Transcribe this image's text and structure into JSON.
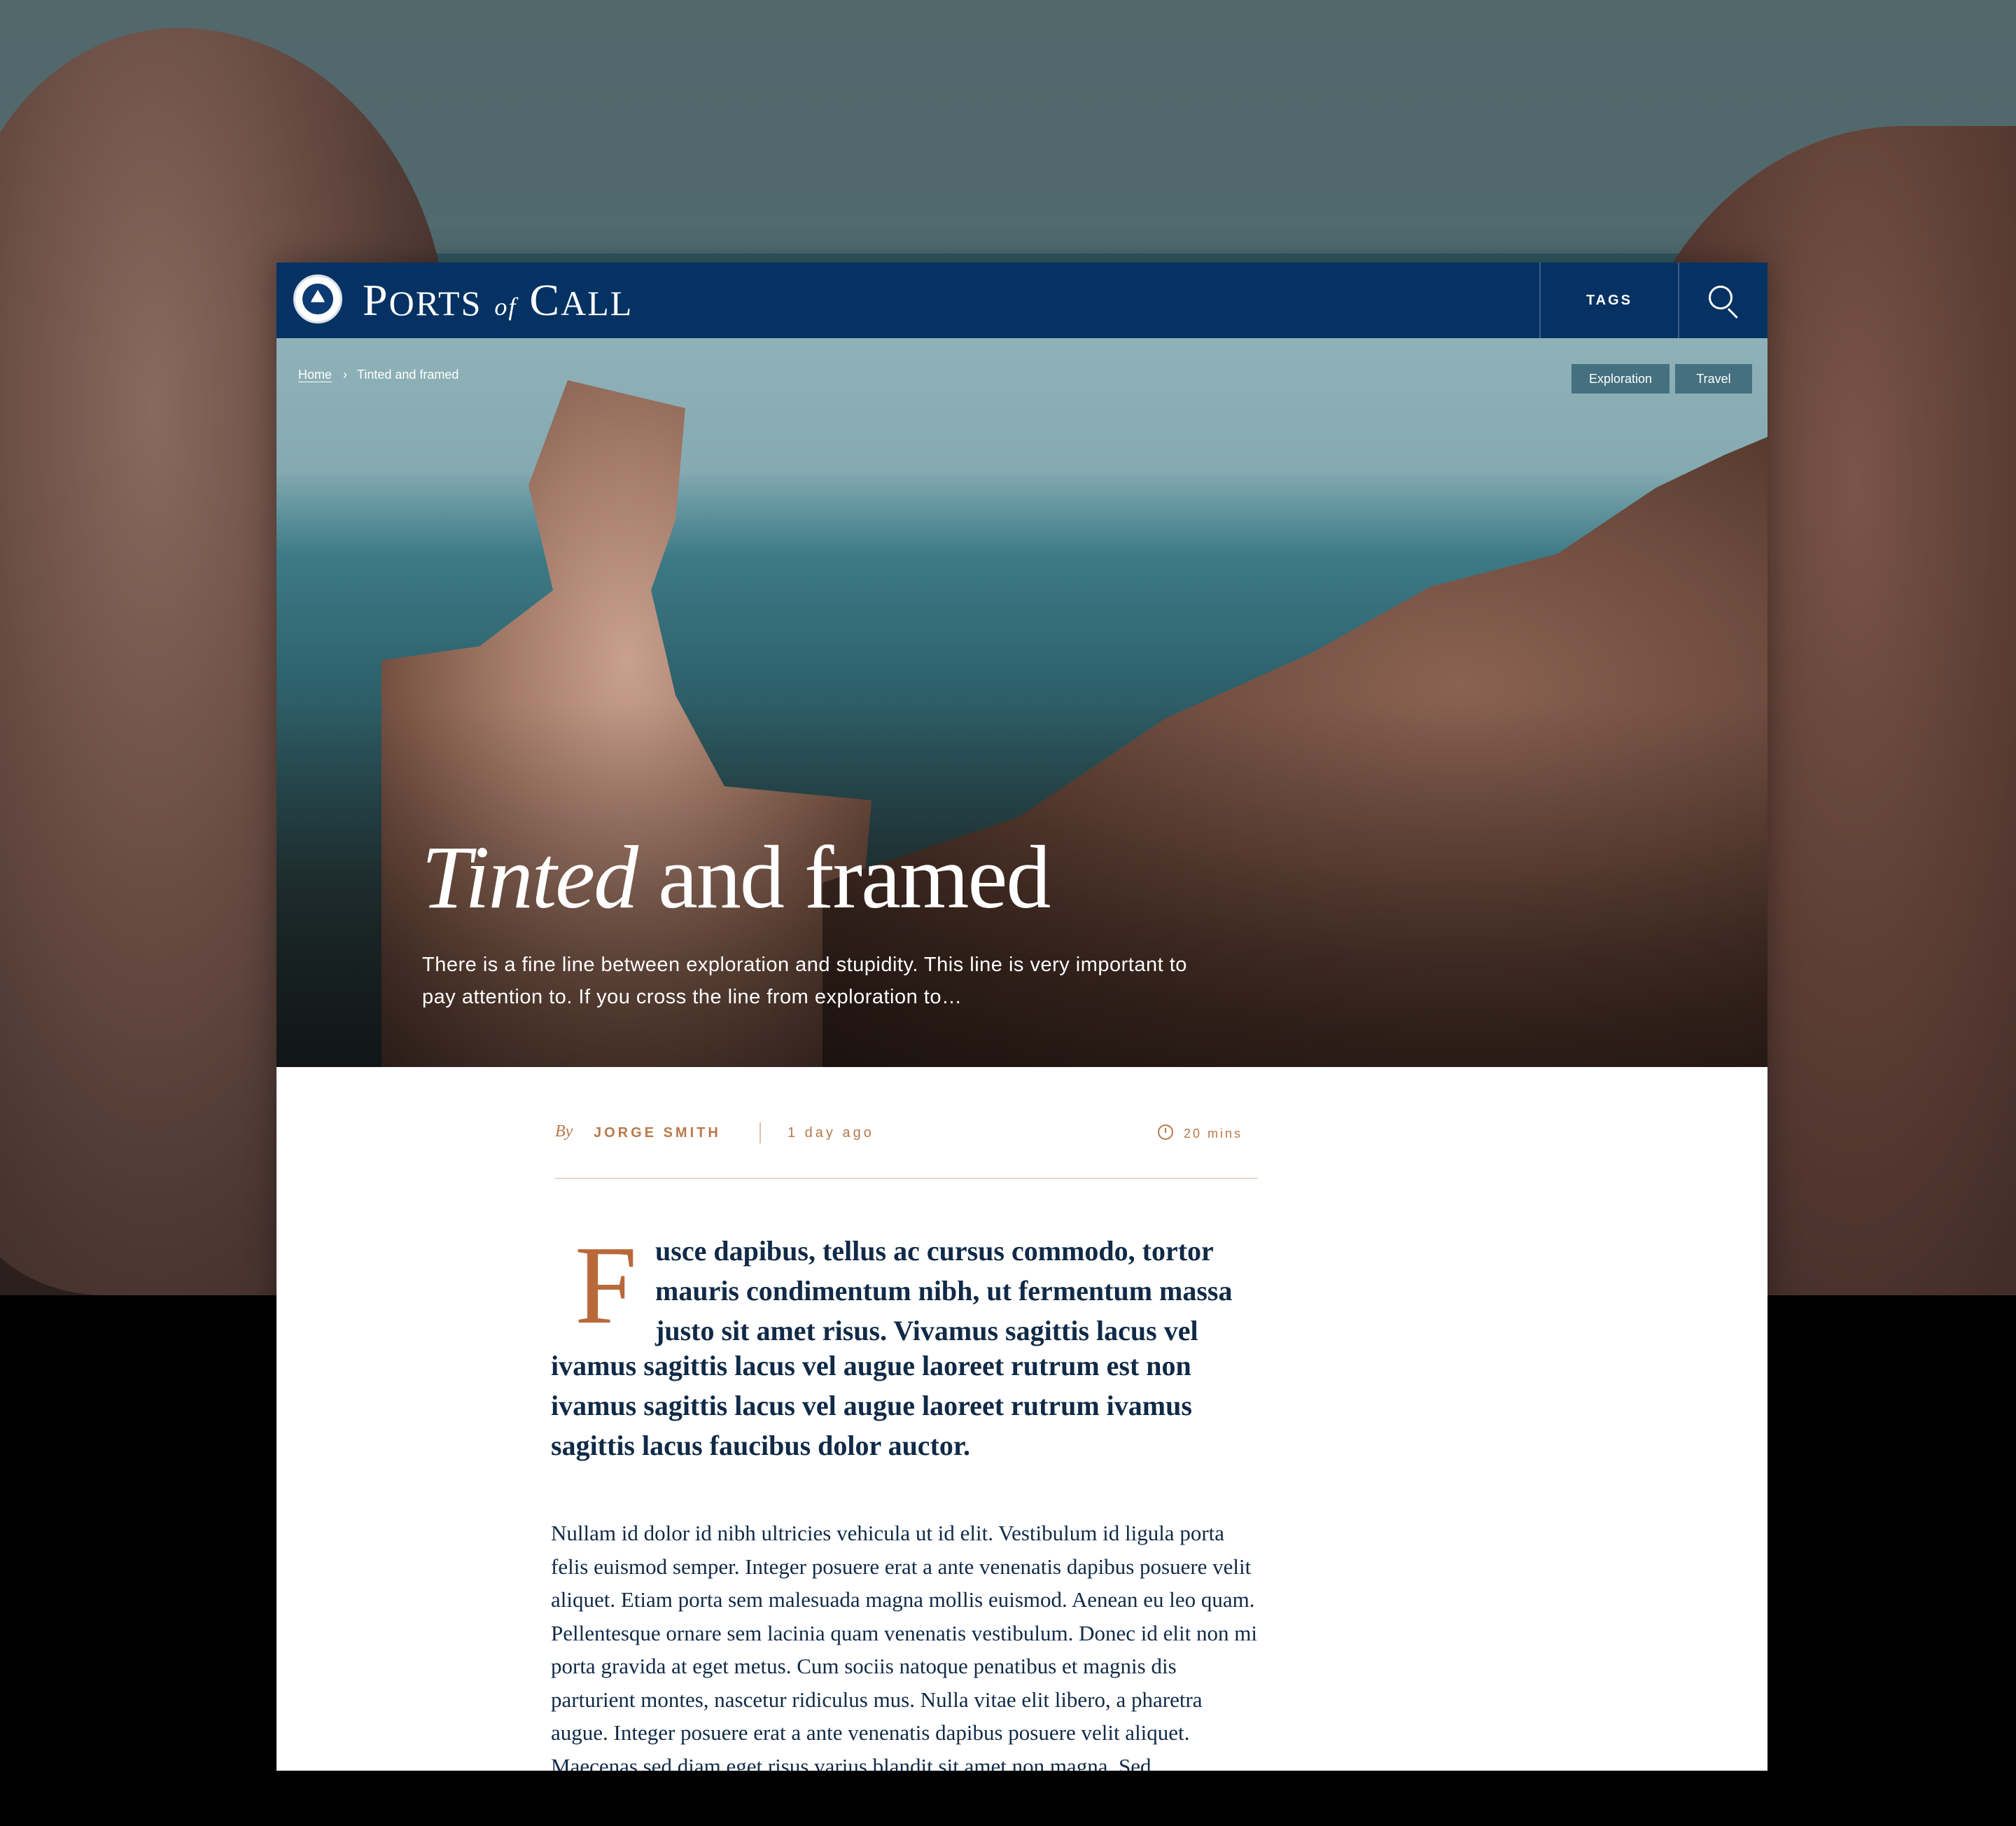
{
  "header": {
    "brand_ports": "P",
    "brand_orts": "ORTS",
    "brand_of": "of",
    "brand_c": "C",
    "brand_all": "ALL",
    "tags_label": "TAGS"
  },
  "breadcrumb": {
    "home": "Home",
    "current": "Tinted and framed"
  },
  "tags": [
    "Exploration",
    "Travel"
  ],
  "hero": {
    "title_italic": "Tinted",
    "title_rest": " and framed",
    "subtitle": "There is a fine line between exploration and stupidity. This line is very important to pay attention to. If you cross the line from exploration to…"
  },
  "meta": {
    "by": "By",
    "author": "JORGE SMITH",
    "posted": "1 day ago",
    "read_time": "20 mins"
  },
  "article": {
    "drop_cap": "F",
    "lead_first": "usce dapibus, tellus ac cursus commodo, tortor mauris condimentum nibh, ut fermentum massa justo sit amet risus. Vivamus sagittis lacus vel",
    "lead_rest": "ivamus sagittis lacus vel augue laoreet rutrum est non ivamus sagittis lacus vel augue laoreet rutrum ivamus sagittis lacus faucibus dolor auctor.",
    "paragraph": "Nullam id dolor id nibh ultricies vehicula ut id elit. Vestibulum id ligula porta felis euismod semper. Integer posuere erat a ante venenatis dapibus posuere velit aliquet. Etiam porta sem malesuada magna mollis euismod. Aenean eu leo quam. Pellentesque ornare sem lacinia quam venenatis vestibulum. Donec id elit non mi porta gravida at eget metus. Cum sociis natoque penatibus et magnis dis parturient montes, nascetur ridiculus mus. Nulla vitae elit libero, a pharetra augue. Integer posuere erat a ante venenatis dapibus posuere velit aliquet. Maecenas sed diam eget risus varius blandit sit amet non magna. Sed"
  }
}
